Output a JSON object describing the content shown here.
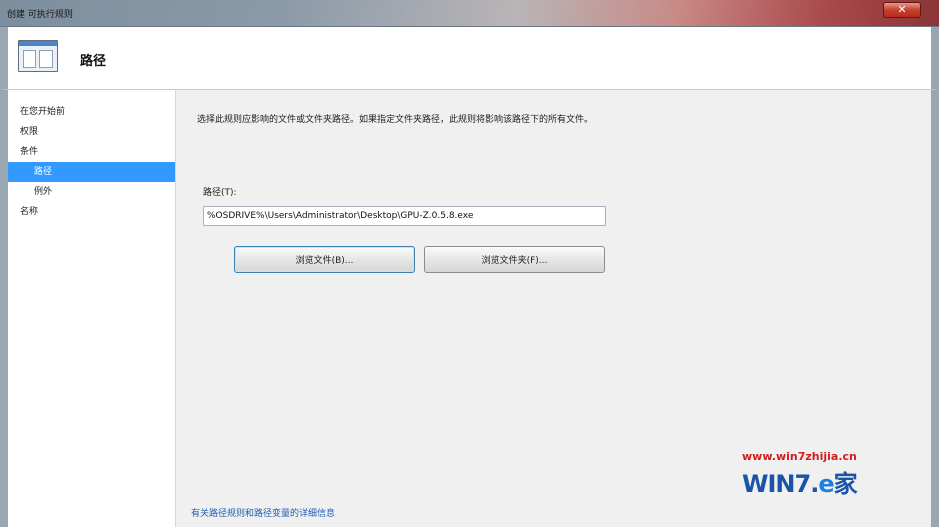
{
  "window": {
    "title": "创建 可执行规则",
    "close_label": "✕"
  },
  "header": {
    "title": "路径",
    "icon": "rule-wizard-icon"
  },
  "sidebar": {
    "items": [
      {
        "label": "在您开始前"
      },
      {
        "label": "权限"
      },
      {
        "label": "条件"
      },
      {
        "label": "路径"
      },
      {
        "label": "例外"
      },
      {
        "label": "名称"
      }
    ]
  },
  "main": {
    "description": "选择此规则应影响的文件或文件夹路径。如果指定文件夹路径，此规则将影响该路径下的所有文件。",
    "path_label": "路径(T):",
    "path_value": "%OSDRIVE%\\Users\\Administrator\\Desktop\\GPU-Z.0.5.8.exe",
    "browse_files_label": "浏览文件(B)...",
    "browse_folders_label": "浏览文件夹(F)...",
    "help_link": "有关路径规则和路径变量的详细信息"
  },
  "watermark": {
    "url": "www.win7zhijia.cn",
    "logo_prefix": "WIN7.",
    "logo_e": "e",
    "logo_han": "家"
  },
  "colors": {
    "selection": "#3399ff",
    "link": "#1f5fb3",
    "watermark_red": "#d31d1d",
    "watermark_blue": "#1954a8"
  }
}
